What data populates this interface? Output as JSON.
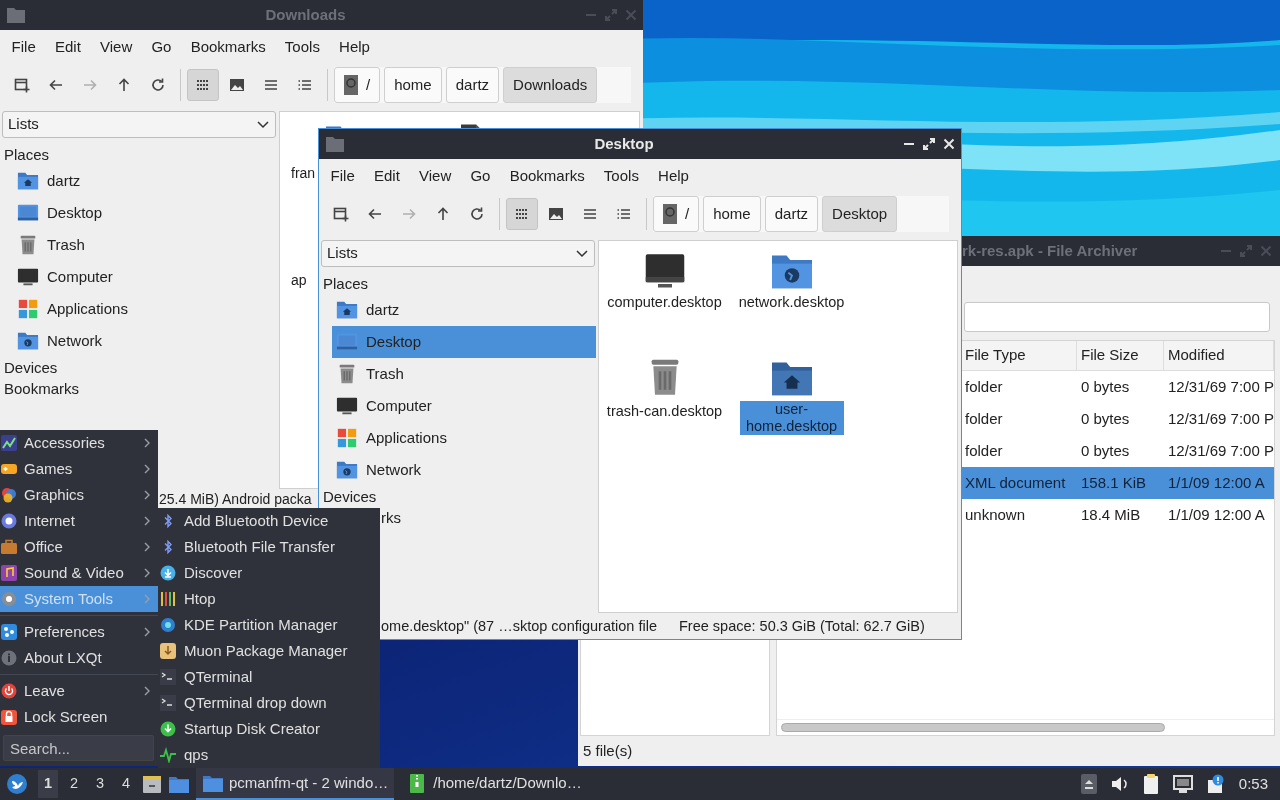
{
  "windows": [
    {
      "kind": "archiver",
      "title": "rk-res.apk - File Archiver",
      "active": false,
      "columns": [
        "File Type",
        "File Size",
        "Modified"
      ],
      "rows": [
        {
          "cells": [
            "folder",
            "0 bytes",
            "12/31/69 7:00 P"
          ],
          "selected": false
        },
        {
          "cells": [
            "folder",
            "0 bytes",
            "12/31/69 7:00 P"
          ],
          "selected": false
        },
        {
          "cells": [
            "folder",
            "0 bytes",
            "12/31/69 7:00 P"
          ],
          "selected": false
        },
        {
          "cells": [
            "XML document",
            "158.1 KiB",
            "1/1/09 12:00 A"
          ],
          "selected": true
        },
        {
          "cells": [
            "unknown",
            "18.4 MiB",
            "1/1/09 12:00 A"
          ],
          "selected": false
        }
      ],
      "status": "5 file(s)"
    },
    {
      "kind": "file_manager",
      "title": "Downloads",
      "active": false,
      "menu": [
        "File",
        "Edit",
        "View",
        "Go",
        "Bookmarks",
        "Tools",
        "Help"
      ],
      "nav_buttons": [
        {
          "disabled": false
        },
        {
          "disabled": false
        },
        {
          "disabled": true
        },
        {
          "disabled": false
        },
        {
          "disabled": false
        }
      ],
      "view_buttons": [
        {
          "selected": true
        },
        {
          "selected": false
        },
        {
          "selected": false
        },
        {
          "selected": false
        }
      ],
      "path": [
        {
          "label": "/",
          "selected": false
        },
        {
          "label": "home",
          "selected": false
        },
        {
          "label": "dartz",
          "selected": false
        },
        {
          "label": "Downloads",
          "selected": true
        }
      ],
      "side_combo": "Lists",
      "sections": [
        {
          "heading": "Places",
          "items": [
            {
              "label": "dartz",
              "selected": false
            },
            {
              "label": "Desktop",
              "selected": false
            },
            {
              "label": "Trash",
              "selected": false
            },
            {
              "label": "Computer",
              "selected": false
            },
            {
              "label": "Applications",
              "selected": false
            },
            {
              "label": "Network",
              "selected": false
            }
          ]
        },
        {
          "heading": "Devices"
        },
        {
          "heading": "Bookmarks"
        }
      ],
      "files": [
        {
          "label": "fran",
          "kind": "folder"
        },
        {
          "kind": "document"
        },
        {
          "label": "ap"
        }
      ],
      "status": [
        "25.4 MiB) Android packa"
      ]
    },
    {
      "kind": "file_manager",
      "title": "Desktop",
      "active": true,
      "menu": [
        "File",
        "Edit",
        "View",
        "Go",
        "Bookmarks",
        "Tools",
        "Help"
      ],
      "nav_buttons": [
        {
          "disabled": false
        },
        {
          "disabled": false
        },
        {
          "disabled": true
        },
        {
          "disabled": false
        },
        {
          "disabled": false
        }
      ],
      "view_buttons": [
        {
          "selected": true
        },
        {
          "selected": false
        },
        {
          "selected": false
        },
        {
          "selected": false
        }
      ],
      "path": [
        {
          "label": "/",
          "selected": false
        },
        {
          "label": "home",
          "selected": false
        },
        {
          "label": "dartz",
          "selected": false
        },
        {
          "label": "Desktop",
          "selected": true
        }
      ],
      "side_combo": "Lists",
      "sections": [
        {
          "heading": "Places",
          "items": [
            {
              "label": "dartz",
              "selected": false
            },
            {
              "label": "Desktop",
              "selected": true
            },
            {
              "label": "Trash",
              "selected": false
            },
            {
              "label": "Computer",
              "selected": false
            },
            {
              "label": "Applications",
              "selected": false
            },
            {
              "label": "Network",
              "selected": false
            }
          ]
        },
        {
          "heading": "Devices"
        },
        {
          "heading": "rks"
        }
      ],
      "files": [
        {
          "label": "computer.desktop",
          "kind": "computer",
          "selected": false
        },
        {
          "label": "network.desktop",
          "kind": "network",
          "selected": false
        },
        {
          "label": "trash-can.desktop",
          "kind": "trash",
          "selected": false
        },
        {
          "label": "user-home.desktop",
          "kind": "home",
          "selected": true
        }
      ],
      "status": [
        "ome.desktop\" (87 …sktop configuration file",
        "Free space: 50.3 GiB (Total: 62.7 GiB)"
      ]
    }
  ],
  "app_menu": {
    "groups": [
      [
        {
          "label": "Accessories",
          "submenu": true,
          "selected": false
        },
        {
          "label": "Games",
          "submenu": true,
          "selected": false
        },
        {
          "label": "Graphics",
          "submenu": true,
          "selected": false
        },
        {
          "label": "Internet",
          "submenu": true,
          "selected": false
        },
        {
          "label": "Office",
          "submenu": true,
          "selected": false
        },
        {
          "label": "Sound & Video",
          "submenu": true,
          "selected": false
        },
        {
          "label": "System Tools",
          "submenu": true,
          "selected": true
        }
      ],
      [
        {
          "label": "Preferences",
          "submenu": true,
          "selected": false
        },
        {
          "label": "About LXQt",
          "submenu": false,
          "selected": false
        }
      ],
      [
        {
          "label": "Leave",
          "submenu": true,
          "selected": false
        },
        {
          "label": "Lock Screen",
          "submenu": false,
          "selected": false
        }
      ]
    ],
    "search": {
      "placeholder": "Search..."
    },
    "submenu_items": [
      "Add Bluetooth Device",
      "Bluetooth File Transfer",
      "Discover",
      "Htop",
      "KDE Partition Manager",
      "Muon Package Manager",
      "QTerminal",
      "QTerminal drop down",
      "Startup Disk Creator",
      "qps"
    ]
  },
  "taskbar": {
    "desktops": [
      {
        "label": "1",
        "selected": true
      },
      {
        "label": "2",
        "selected": false
      },
      {
        "label": "3",
        "selected": false
      },
      {
        "label": "4",
        "selected": false
      }
    ],
    "tasks": [
      {
        "label": "pcmanfm-qt - 2 windo…",
        "selected": true
      },
      {
        "label": "/home/dartz/Downlo…",
        "selected": false
      }
    ],
    "clock": "0:53"
  }
}
